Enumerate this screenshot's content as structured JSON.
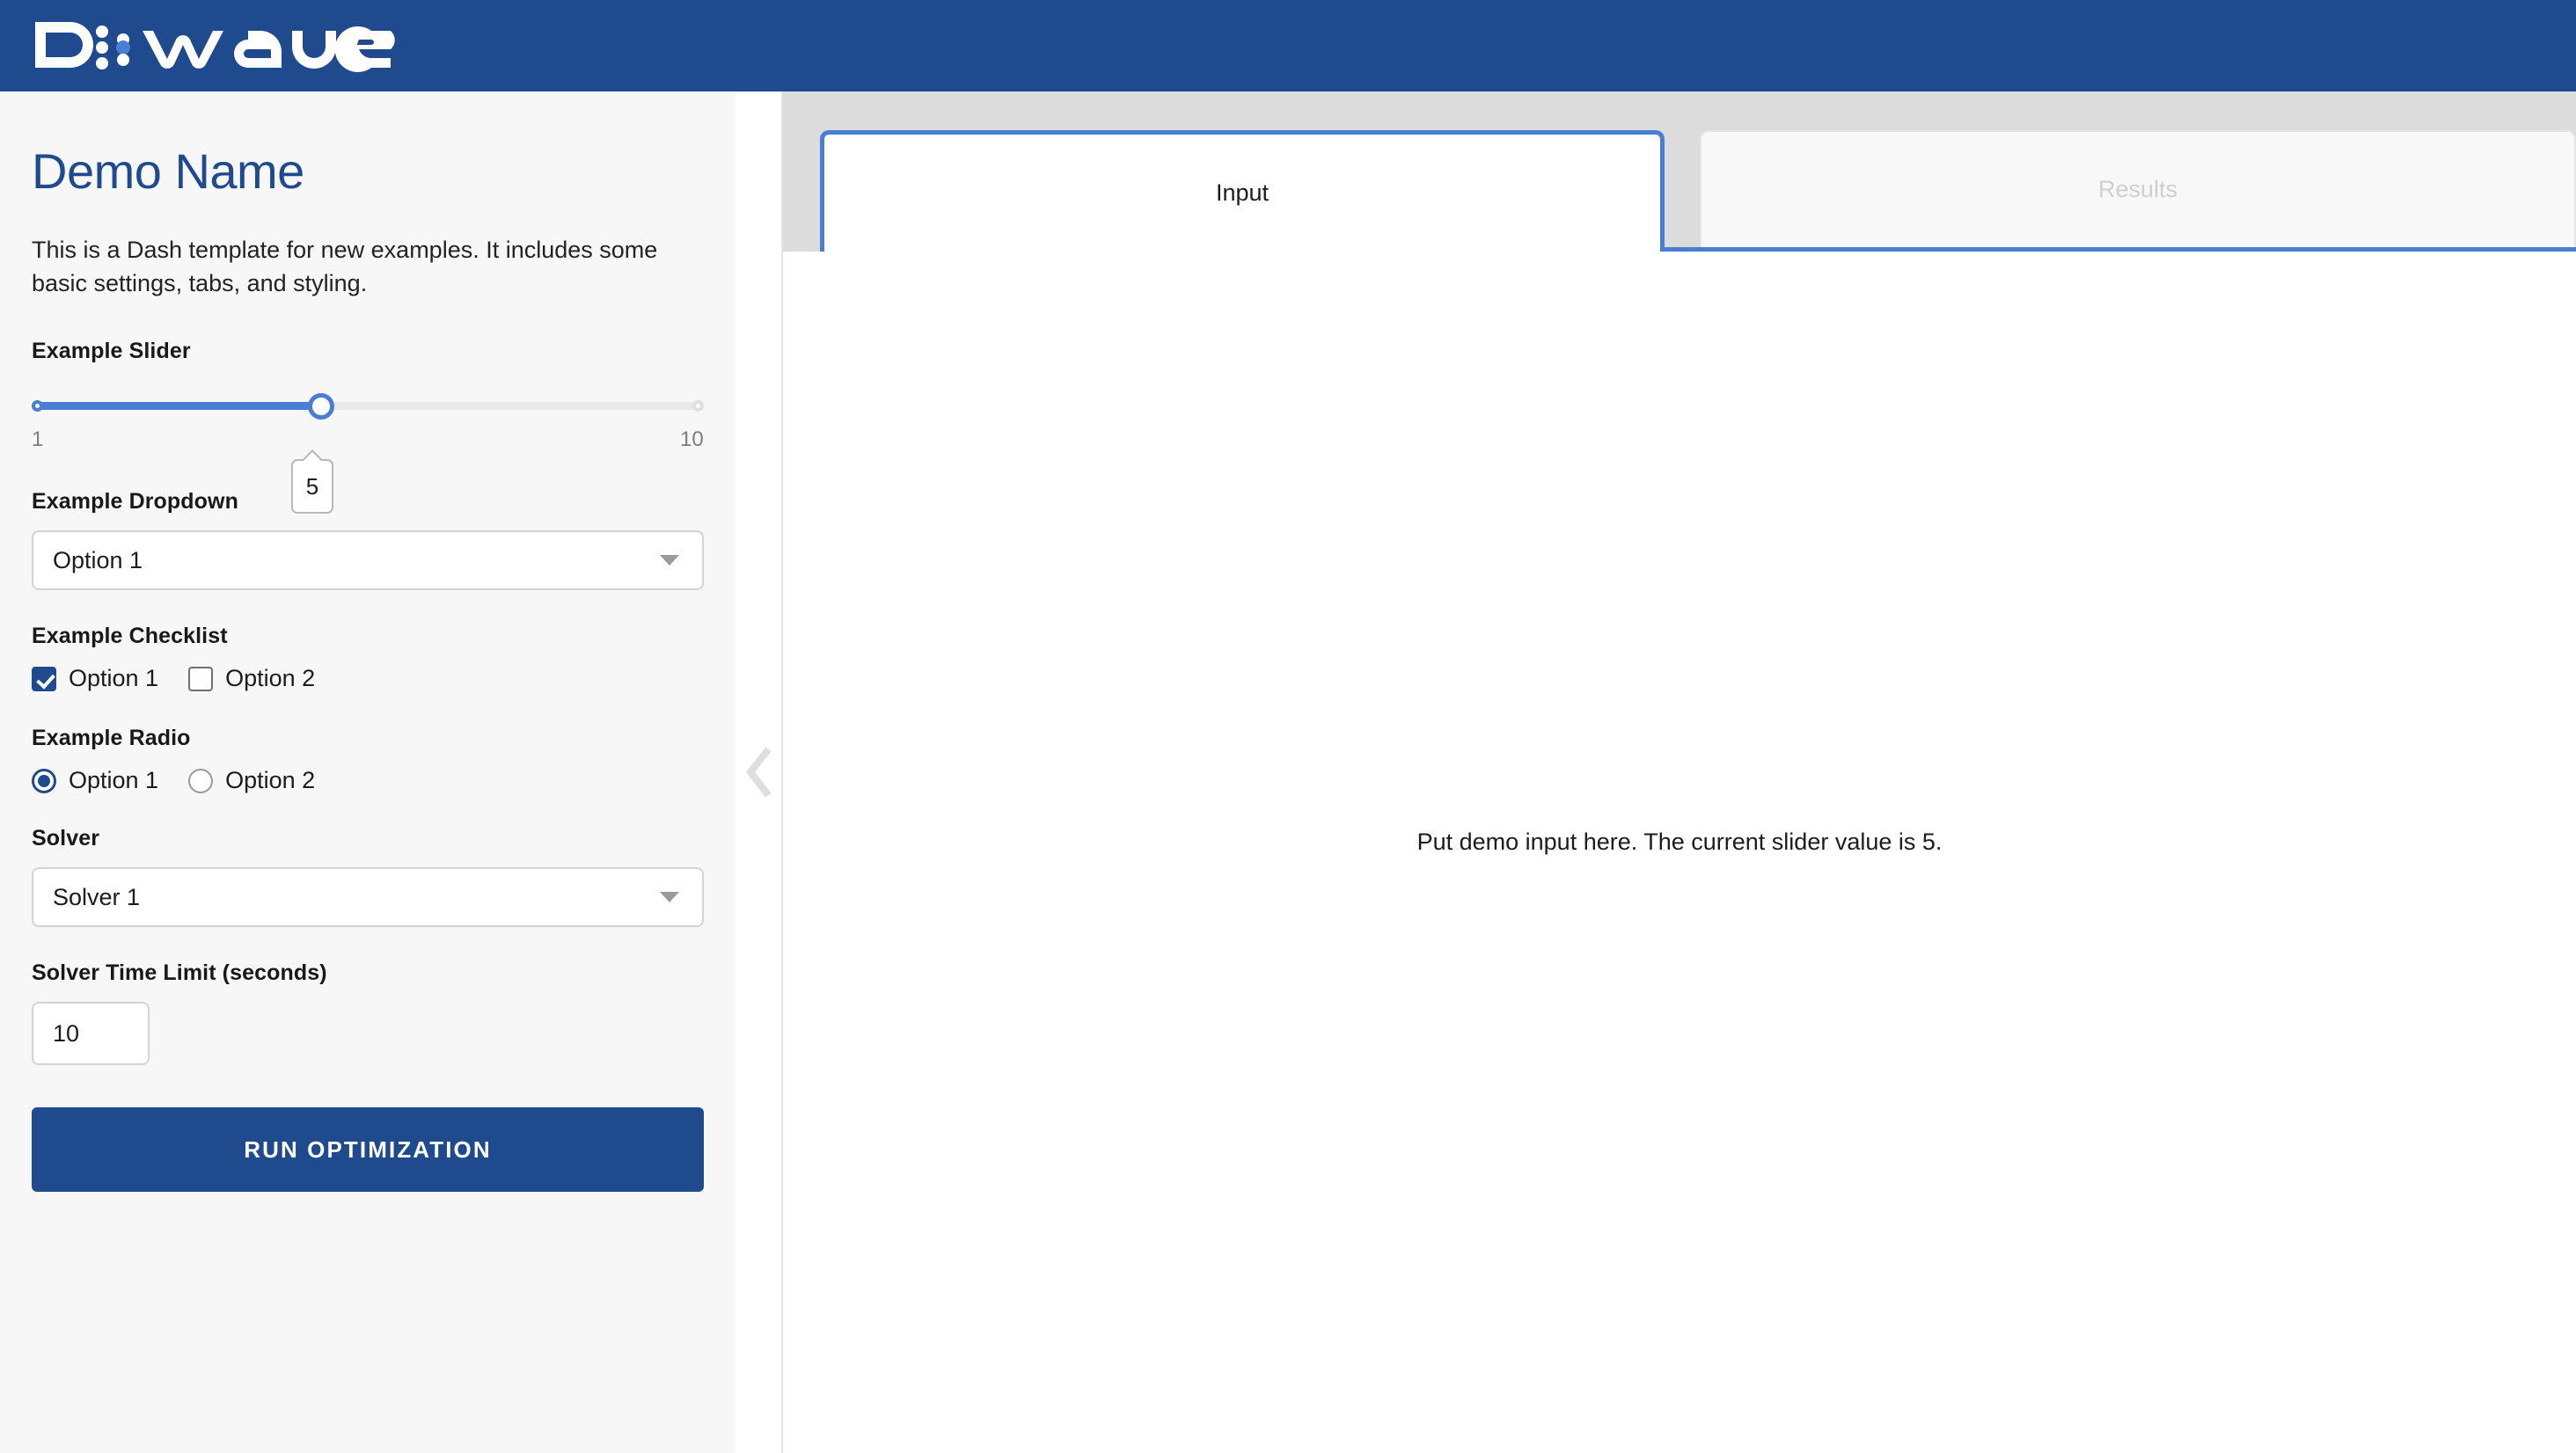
{
  "brand": {
    "logo_name": "dwave-logo",
    "logo_alt": "D-Wave",
    "bar_color": "#1f4b8e"
  },
  "sidebar": {
    "title": "Demo Name",
    "description": "This is a Dash template for new examples. It includes some basic settings, tabs, and styling.",
    "slider": {
      "label": "Example Slider",
      "min_label": "1",
      "max_label": "10",
      "value": "5",
      "min": 1,
      "max": 10,
      "fill_color": "#4a7ed4"
    },
    "dropdown": {
      "label": "Example Dropdown",
      "value": "Option 1",
      "caret_icon": "chevron-down-icon"
    },
    "checklist": {
      "label": "Example Checklist",
      "items": [
        {
          "label": "Option 1",
          "checked": true
        },
        {
          "label": "Option 2",
          "checked": false
        }
      ]
    },
    "radio": {
      "label": "Example Radio",
      "items": [
        {
          "label": "Option 1",
          "selected": true
        },
        {
          "label": "Option 2",
          "selected": false
        }
      ]
    },
    "solver": {
      "label": "Solver",
      "value": "Solver 1",
      "caret_icon": "chevron-down-icon"
    },
    "time_limit": {
      "label": "Solver Time Limit (seconds)",
      "value": "10"
    },
    "run_button": {
      "label": "RUN OPTIMIZATION",
      "color": "#1f4b8e"
    },
    "collapse_handle": {
      "icon": "chevron-left-icon"
    }
  },
  "main": {
    "tabs": [
      {
        "label": "Input",
        "active": true,
        "disabled": false
      },
      {
        "label": "Results",
        "active": false,
        "disabled": true
      }
    ],
    "content": {
      "text": "Put demo input here. The current slider value is 5."
    },
    "accent_color": "#4a7ed4"
  }
}
